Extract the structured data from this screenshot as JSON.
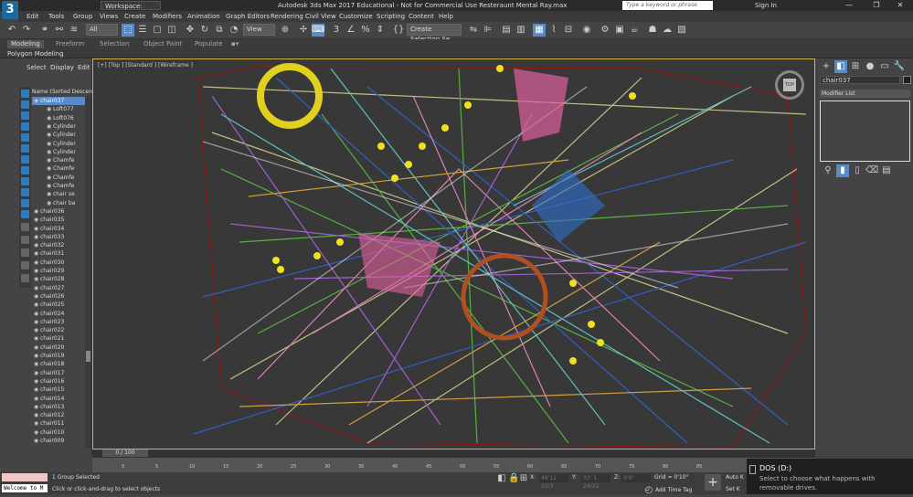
{
  "titlebar": {
    "workspace": "Workspace: Default",
    "title": "Autodesk 3ds Max 2017 Educational - Not for Commercial Use    Resteraunt Mental Ray.max",
    "search_placeholder": "Type a keyword or phrase",
    "signin": "Sign In",
    "minimize": "—",
    "maximize": "❐",
    "close": "✕"
  },
  "menu": [
    "Edit",
    "Tools",
    "Group",
    "Views",
    "Create",
    "Modifiers",
    "Animation",
    "Graph Editors",
    "Rendering",
    "Civil View",
    "Customize",
    "Scripting",
    "Content",
    "Help"
  ],
  "toolbar": {
    "filter": "All",
    "view": "View",
    "selection_set": "Create Selection Se"
  },
  "ribbon": {
    "tabs": [
      "Modeling",
      "Freeform",
      "Selection",
      "Object Paint",
      "Populate"
    ],
    "active_tab": "Modeling",
    "sub": "Polygon Modeling"
  },
  "scene_explorer": {
    "tabs": [
      "Select",
      "Display",
      "Edit"
    ],
    "header": "Name (Sorted Descending)",
    "items": [
      "chair037",
      "Loft077",
      "Loft076",
      "Cylinder",
      "Cylinder",
      "Cylinder",
      "Cylinder",
      "Chamfe",
      "Chamfe",
      "Chamfe",
      "Chamfe",
      "chair se",
      "chair ba",
      "chair036",
      "chair035",
      "chair034",
      "chair033",
      "chair032",
      "chair031",
      "chair030",
      "chair029",
      "chair028",
      "chair027",
      "chair026",
      "chair025",
      "chair024",
      "chair023",
      "chair022",
      "chair021",
      "chair020",
      "chair019",
      "chair018",
      "chair017",
      "chair016",
      "chair015",
      "chair014",
      "chair013",
      "chair012",
      "chair011",
      "chair010",
      "chair009"
    ]
  },
  "viewport": {
    "label": "[+] [Top ] [Standard ] [Wireframe ]",
    "cube_face": "TOP"
  },
  "command_panel": {
    "object_name": "chair037",
    "modifier_list": "Modifier List"
  },
  "timeline": {
    "frame": "0 / 100",
    "ticks": [
      "0",
      "5",
      "10",
      "15",
      "20",
      "25",
      "30",
      "35",
      "40",
      "45",
      "50",
      "55",
      "60",
      "65",
      "70",
      "75",
      "80",
      "85"
    ]
  },
  "status": {
    "maxscript_welcome": "Welcome to M",
    "selection": "1 Group Selected",
    "prompt": "Click or click-and-drag to select objects",
    "x_label": "X:",
    "x_value": "49'11 10/3",
    "y_label": "Y:",
    "y_value": "33' 1 24/32",
    "z_label": "Z:",
    "z_value": "0'0\"",
    "grid": "Grid = 0'10\"",
    "add_time_tag": "Add Time Tag",
    "auto_key": "Auto K",
    "set_key": "Set K"
  },
  "toast": {
    "title": "DOS (D:)",
    "body": "Select to choose what happens with removable drives."
  }
}
